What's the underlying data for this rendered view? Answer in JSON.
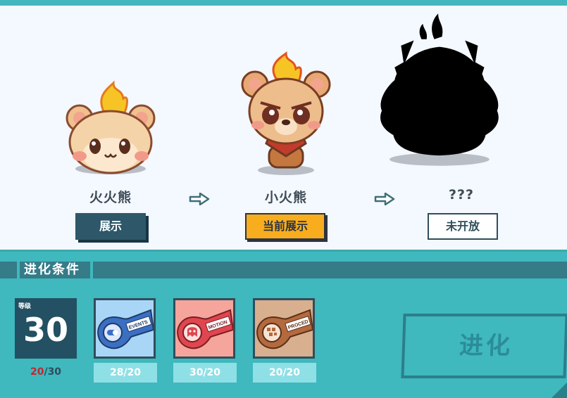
{
  "stages": [
    {
      "name": "火火熊",
      "button_label": "展示",
      "state": "show"
    },
    {
      "name": "小火熊",
      "button_label": "当前展示",
      "state": "current"
    },
    {
      "name": "???",
      "button_label": "未开放",
      "state": "locked"
    }
  ],
  "section": {
    "title": "进化条件"
  },
  "level": {
    "label": "等级",
    "value": "30",
    "current": "20",
    "separator": "/",
    "required": "30"
  },
  "items": [
    {
      "icon": "events-key-icon",
      "badge_text": "EVENTS",
      "count": "28/20",
      "color": "#a9d6f7"
    },
    {
      "icon": "motion-key-icon",
      "badge_text": "MOTION",
      "count": "30/20",
      "color": "#f5a59c"
    },
    {
      "icon": "procedure-key-icon",
      "badge_text": "PROCED",
      "count": "20/20",
      "color": "#d9b08f"
    }
  ],
  "evolve": {
    "label": "进化"
  },
  "colors": {
    "background": "#3fb8be",
    "panel": "#f4f8ff",
    "dark_button": "#2e5769",
    "current_button": "#f8ad1f",
    "level_red": "#c8262c"
  }
}
